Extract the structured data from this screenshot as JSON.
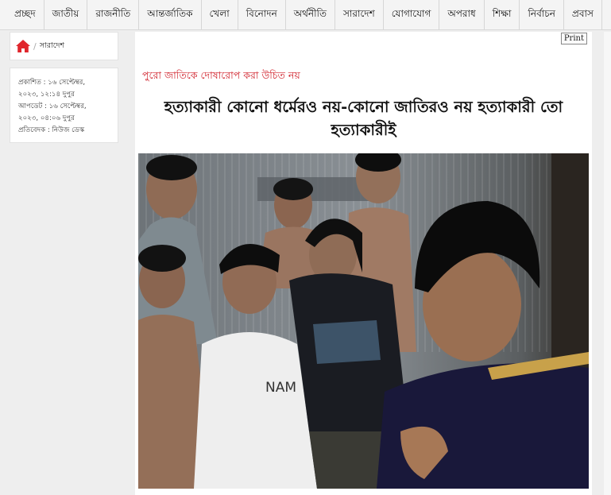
{
  "nav": {
    "items": [
      "প্রচ্ছদ",
      "জাতীয়",
      "রাজনীতি",
      "আন্তর্জাতিক",
      "খেলা",
      "বিনোদন",
      "অর্থনীতি",
      "সারাদেশ",
      "যোগাযোগ",
      "অপরাধ",
      "শিক্ষা",
      "নির্বাচন",
      "প্রবাস"
    ]
  },
  "breadcrumb": {
    "section": "সারাদেশ"
  },
  "meta": {
    "published": "প্রকাশিত : ১৬ সেপ্টেম্বর,",
    "published_time": "২০২৩, ১২:১৪ দুপুর",
    "updated": "আপডেট : ১৬ সেপ্টেম্বর,",
    "updated_time": "২০২৩, ০৪:০৬ দুপুর",
    "reporter": "প্রতিবেদক : নিউজ ডেস্ক"
  },
  "article": {
    "print_label": "Print",
    "kicker": "পুরো জাতিকে দোষারোপ করা উচিত নয়",
    "headline": "হত্যাকারী কোনো ধর্মেরও নয়-কোনো জাতিরও নয় হত্যাকারী তো হত্যাকারীই",
    "shirt_text": "NAM"
  },
  "colors": {
    "kicker": "#d0202a",
    "home_icon": "#e0262c"
  }
}
